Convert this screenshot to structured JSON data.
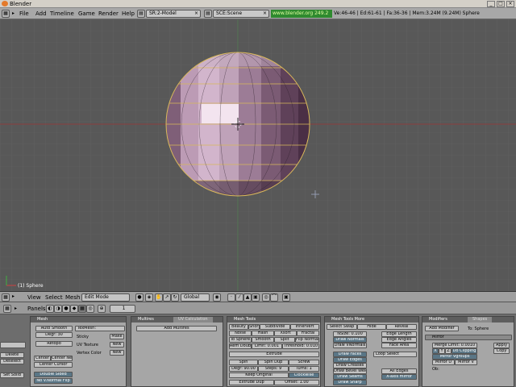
{
  "window": {
    "title": "Blender",
    "controls": [
      "_",
      "□",
      "×"
    ]
  },
  "menubar": {
    "items": [
      "File",
      "Add",
      "Timeline",
      "Game",
      "Render",
      "Help"
    ],
    "screen": "SR:2-Model",
    "scene": "SCE:Scene",
    "url": "www.blender.org 249.2",
    "stats": "Ve:46-46 | Ed:61-61 | Fa:36-36 | Mem:3.24M (9.24M) Sphere"
  },
  "viewport": {
    "object_label": "(1) Sphere"
  },
  "header3d": {
    "menus": [
      "View",
      "Select",
      "Mesh"
    ],
    "mode": "Edit Mode",
    "orientation": "Global"
  },
  "buttons_header": {
    "panels_label": "Panels",
    "frame": "1"
  },
  "left_panel": {
    "buttons": [
      "Delete",
      "Deselect",
      "Set Solid"
    ]
  },
  "mesh_panel": {
    "title": "Mesh",
    "auto_smooth": "Auto Smooth",
    "degr": "Degr: 30",
    "retopo": "Retopo",
    "center": "Center",
    "center_new": "Center New",
    "center_cursor": "Center Cursor",
    "double_sided": "Double Sided",
    "no_v_normal_flip": "No V.Normal Flip",
    "texmesh": "TexMesh:",
    "sticky": "Sticky",
    "make": "Make",
    "uv_texture": "UV Texture",
    "new1": "New",
    "vertex_color": "Vertex Color",
    "new2": "New"
  },
  "multires_panel": {
    "title": "Multires",
    "tab2": "UV Calculation",
    "add_multires": "Add Multires"
  },
  "mesh_tools_panel": {
    "title": "Mesh Tools",
    "rows": [
      [
        "Beauty",
        "Short",
        "Subdivide",
        "Innervert"
      ],
      [
        "Noise",
        "Hash",
        "Xsort",
        "Fractal"
      ],
      [
        "To Sphere",
        "Smooth",
        "Split",
        "Flip Normal"
      ],
      [
        "Rem Doubles",
        "Limit: 0.001",
        "Threshold: 0.010"
      ]
    ],
    "extrude": "Extrude",
    "spin": "Spin",
    "spin_dup": "Spin Dup",
    "screw": "Screw",
    "degr90": "Degr: 90.00",
    "steps": "Steps: 9",
    "turns": "Turns: 1",
    "keep_original": "Keep Original",
    "clockwise": "Clockwise",
    "extrude_dup": "Extrude Dup",
    "offset": "Offset: 1.00"
  },
  "mesh_tools_more": {
    "title": "Mesh Tools More",
    "select_swap": "Select Swap",
    "hide": "Hide",
    "reveal": "Reveal",
    "nsize": "NSize: 0.100",
    "draw_normals": "Draw Normals",
    "draw_vnormals": "Draw VNormals",
    "edge_length": "Edge Length",
    "edge_angles": "Edge Angles",
    "face_area": "Face Area",
    "draw_faces": "Draw Faces",
    "draw_edges": "Draw Edges",
    "draw_creases": "Draw Creases",
    "draw_bevel_weights": "Draw Bevel Weights",
    "draw_seams": "Draw Seams",
    "draw_sharp": "Draw Sharp",
    "loop_select": "Loop Select",
    "all_edges": "All Edges",
    "x_axis_mirror": "X-axis mirror"
  },
  "modifiers_panel": {
    "title": "Modifiers",
    "tab2": "Shapes",
    "add_modifier": "Add Modifier",
    "to": "To: Sphere",
    "mirror": "Mirror",
    "merge_limit": "Merge Limit: 0.0010",
    "x": "X",
    "y": "Y",
    "z": "Z",
    "do_clipping": "Do Clipping",
    "mirror_vgroups": "Mirror Vgroups",
    "mirror_u": "Mirror U",
    "mirror_v": "Mirror V",
    "ob": "Ob:",
    "apply": "Apply",
    "copy": "Copy"
  },
  "colors": {
    "viewport_bg": "#585858",
    "sphere_fill": "#a7839f",
    "wire_selected": "#e0c060",
    "url_bg": "#2f8a2f"
  }
}
